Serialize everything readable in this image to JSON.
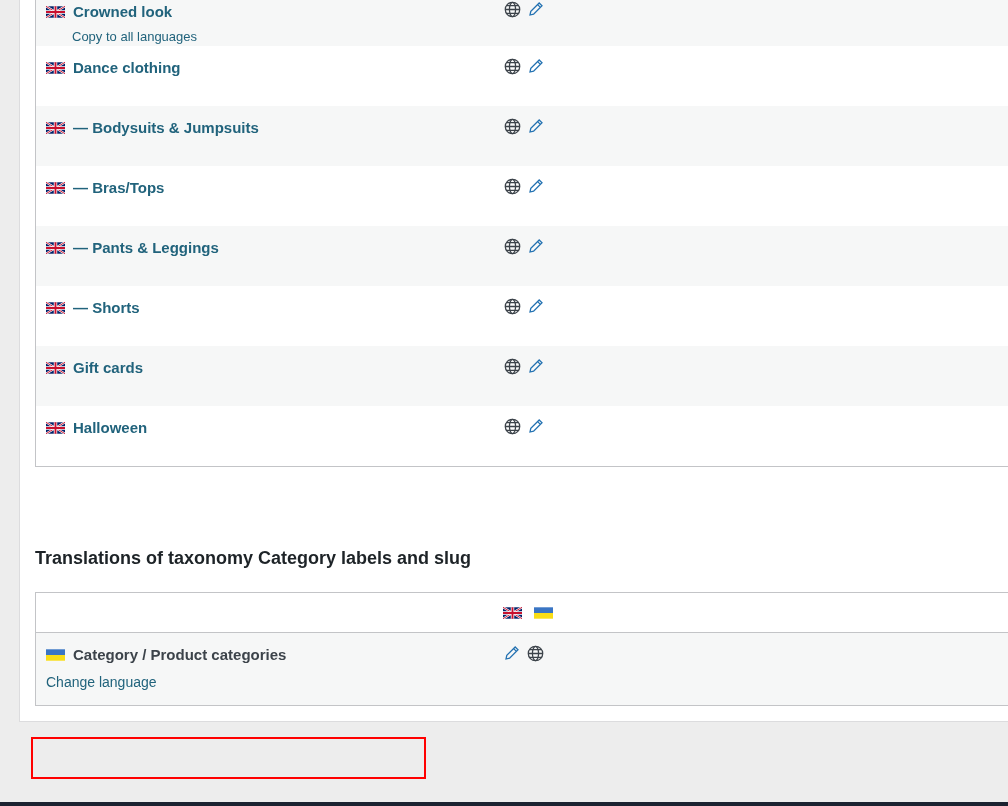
{
  "category_rows": [
    {
      "flag": {
        "kind": "uk"
      },
      "name": "Crowned look",
      "link": "Copy to all languages",
      "actions": [
        {
          "kind": "globe"
        },
        {
          "kind": "edit"
        }
      ]
    },
    {
      "flag": {
        "kind": "uk"
      },
      "name": "Dance clothing",
      "actions": [
        {
          "kind": "globe"
        },
        {
          "kind": "edit"
        }
      ]
    },
    {
      "flag": {
        "kind": "uk"
      },
      "name": "— Bodysuits & Jumpsuits",
      "actions": [
        {
          "kind": "globe"
        },
        {
          "kind": "edit"
        }
      ]
    },
    {
      "flag": {
        "kind": "uk"
      },
      "name": "— Bras/Tops",
      "actions": [
        {
          "kind": "globe"
        },
        {
          "kind": "edit"
        }
      ]
    },
    {
      "flag": {
        "kind": "uk"
      },
      "name": "— Pants & Leggings",
      "actions": [
        {
          "kind": "globe"
        },
        {
          "kind": "edit"
        }
      ]
    },
    {
      "flag": {
        "kind": "uk"
      },
      "name": "— Shorts",
      "actions": [
        {
          "kind": "globe"
        },
        {
          "kind": "edit"
        }
      ]
    },
    {
      "flag": {
        "kind": "uk"
      },
      "name": "Gift cards",
      "actions": [
        {
          "kind": "globe"
        },
        {
          "kind": "edit"
        }
      ]
    },
    {
      "flag": {
        "kind": "uk"
      },
      "name": "Halloween",
      "actions": [
        {
          "kind": "globe"
        },
        {
          "kind": "edit"
        }
      ]
    }
  ],
  "section_title": "Translations of taxonomy Category labels and slug",
  "labels_table": {
    "header_flags": [
      {
        "kind": "uk"
      },
      {
        "kind": "ua"
      }
    ],
    "rows": [
      {
        "flag": {
          "kind": "ua"
        },
        "name": "Category / Product categories",
        "link": "Change language",
        "actions": [
          {
            "kind": "edit"
          },
          {
            "kind": "globe"
          }
        ]
      }
    ]
  }
}
